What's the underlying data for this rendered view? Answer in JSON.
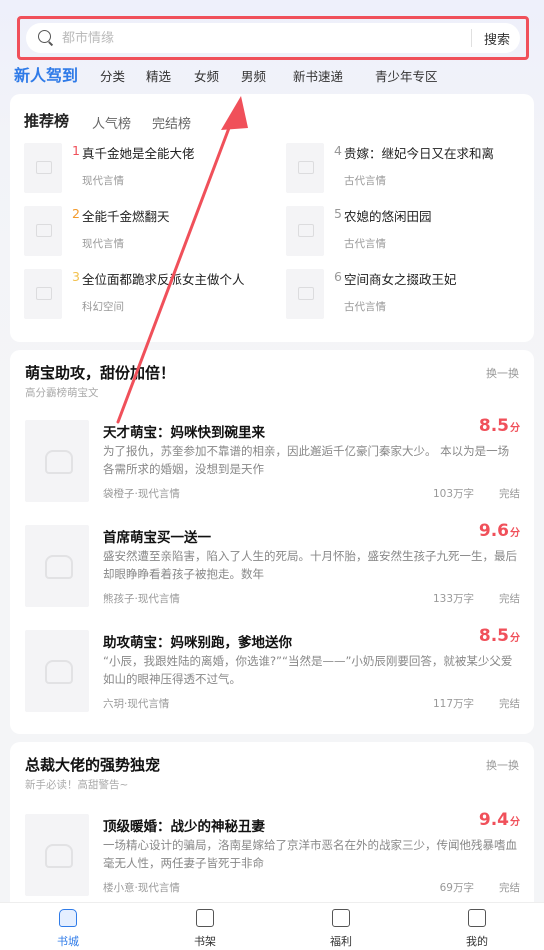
{
  "search": {
    "placeholder": "都市情缘",
    "button": "搜索"
  },
  "tabs": [
    "新人驾到",
    "分类",
    "精选",
    "女频",
    "男频",
    "新书速递",
    "青少年专区"
  ],
  "rank": {
    "tabs": [
      "推荐榜",
      "人气榜",
      "完结榜"
    ],
    "items": [
      {
        "num": "1",
        "title": "真千金她是全能大佬",
        "genre": "现代言情"
      },
      {
        "num": "2",
        "title": "全能千金燃翻天",
        "genre": "现代言情"
      },
      {
        "num": "3",
        "title": "全位面都跪求反派女主做个人",
        "genre": "科幻空间"
      },
      {
        "num": "4",
        "title": "贵嫁：继妃今日又在求和离",
        "genre": "古代言情"
      },
      {
        "num": "5",
        "title": "农媳的悠闲田园",
        "genre": "古代言情"
      },
      {
        "num": "6",
        "title": "空间商女之掇政王妃",
        "genre": "古代言情"
      }
    ],
    "num_colors": [
      "#f0505a",
      "#f39a2b",
      "#f2c14e",
      "#999999",
      "#999999",
      "#999999"
    ]
  },
  "section1": {
    "title": "萌宝助攻，甜份加倍！",
    "subtitle": "高分霸榜萌宝文",
    "refresh": "换一换",
    "books": [
      {
        "title": "天才萌宝：妈咪快到碗里来",
        "score": "8.5",
        "unit": "分",
        "desc": "为了报仇，苏奎参加不靠谱的相亲，因此邂逅千亿豪门秦家大少。 本以为是一场各需所求的婚姻，没想到是天作",
        "author": "袋橙子·现代言情",
        "words": "103万字",
        "status": "完结"
      },
      {
        "title": "首席萌宝买一送一",
        "score": "9.6",
        "unit": "分",
        "desc": "盛安然遭至亲陷害，陷入了人生的死局。十月怀胎，盛安然生孩子九死一生，最后却眼睁睁看着孩子被抱走。数年",
        "author": "熊孩子·现代言情",
        "words": "133万字",
        "status": "完结"
      },
      {
        "title": "助攻萌宝：妈咪别跑，爹地送你",
        "score": "8.5",
        "unit": "分",
        "desc": "“小辰，我跟姓陆的离婚，你选谁?”“当然是——”小奶辰刚要回答，就被某少父爱如山的眼神压得透不过气。",
        "author": "六玥·现代言情",
        "words": "117万字",
        "status": "完结"
      }
    ]
  },
  "section2": {
    "title": "总裁大佬的强势独宠",
    "subtitle": "新手必读！高甜警告~",
    "refresh": "换一换",
    "books": [
      {
        "title": "顶级暖婚：战少的神秘丑妻",
        "score": "9.4",
        "unit": "分",
        "desc": "一场精心设计的骗局，洛南星嫁给了京洋市恶名在外的战家三少，传闻他残暴嗜血毫无人性，两任妻子皆死于非命",
        "author": "楼小意·现代言情",
        "words": "69万字",
        "status": "完结"
      }
    ]
  },
  "nav": [
    "书城",
    "书架",
    "福利",
    "我的"
  ],
  "colors": {
    "accent": "#2f7be8",
    "score": "#f0505a",
    "annotation": "#f0505a"
  }
}
